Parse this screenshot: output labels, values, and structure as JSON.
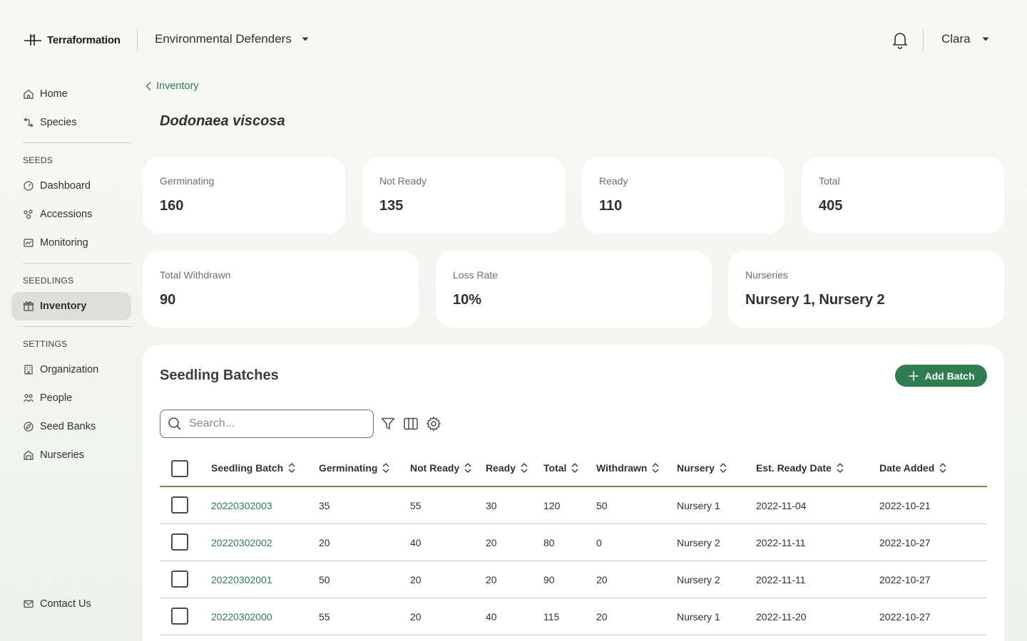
{
  "header": {
    "brand": "Terraformation",
    "organization": "Environmental Defenders",
    "user": "Clara"
  },
  "sidebar": {
    "top_items": [
      {
        "label": "Home",
        "icon": "home-icon"
      },
      {
        "label": "Species",
        "icon": "species-icon"
      }
    ],
    "sections": [
      {
        "title": "SEEDS",
        "items": [
          {
            "label": "Dashboard",
            "icon": "dashboard-icon"
          },
          {
            "label": "Accessions",
            "icon": "accessions-icon"
          },
          {
            "label": "Monitoring",
            "icon": "monitoring-icon"
          }
        ]
      },
      {
        "title": "SEEDLINGS",
        "items": [
          {
            "label": "Inventory",
            "icon": "inventory-icon",
            "active": true
          }
        ]
      },
      {
        "title": "SETTINGS",
        "items": [
          {
            "label": "Organization",
            "icon": "organization-icon"
          },
          {
            "label": "People",
            "icon": "people-icon"
          },
          {
            "label": "Seed Banks",
            "icon": "seed-banks-icon"
          },
          {
            "label": "Nurseries",
            "icon": "nurseries-icon"
          }
        ]
      }
    ],
    "footer_item": {
      "label": "Contact Us",
      "icon": "mail-icon"
    }
  },
  "breadcrumb": {
    "label": "Inventory"
  },
  "page": {
    "title": "Dodonaea viscosa"
  },
  "stats_row1": [
    {
      "label": "Germinating",
      "value": "160"
    },
    {
      "label": "Not Ready",
      "value": "135"
    },
    {
      "label": "Ready",
      "value": "110"
    },
    {
      "label": "Total",
      "value": "405"
    }
  ],
  "stats_row2": [
    {
      "label": "Total Withdrawn",
      "value": "90"
    },
    {
      "label": "Loss Rate",
      "value": "10%"
    },
    {
      "label": "Nurseries",
      "value": "Nursery 1, Nursery 2"
    }
  ],
  "batches": {
    "title": "Seedling Batches",
    "add_button": "Add Batch",
    "search_placeholder": "Search...",
    "columns": [
      "Seedling Batch",
      "Germinating",
      "Not Ready",
      "Ready",
      "Total",
      "Withdrawn",
      "Nursery",
      "Est. Ready Date",
      "Date Added"
    ],
    "rows": [
      [
        "20220302003",
        "35",
        "55",
        "30",
        "120",
        "50",
        "Nursery 1",
        "2022-11-04",
        "2022-10-21"
      ],
      [
        "20220302002",
        "20",
        "40",
        "20",
        "80",
        "0",
        "Nursery 2",
        "2022-11-11",
        "2022-10-27"
      ],
      [
        "20220302001",
        "50",
        "20",
        "20",
        "90",
        "20",
        "Nursery 2",
        "2022-11-11",
        "2022-10-27"
      ],
      [
        "20220302000",
        "55",
        "20",
        "40",
        "115",
        "20",
        "Nursery 1",
        "2022-11-20",
        "2022-10-27"
      ]
    ]
  },
  "colors": {
    "accent": "#317d52",
    "active_nav": "#dedfd6",
    "header_rule": "#8a7d5c"
  }
}
